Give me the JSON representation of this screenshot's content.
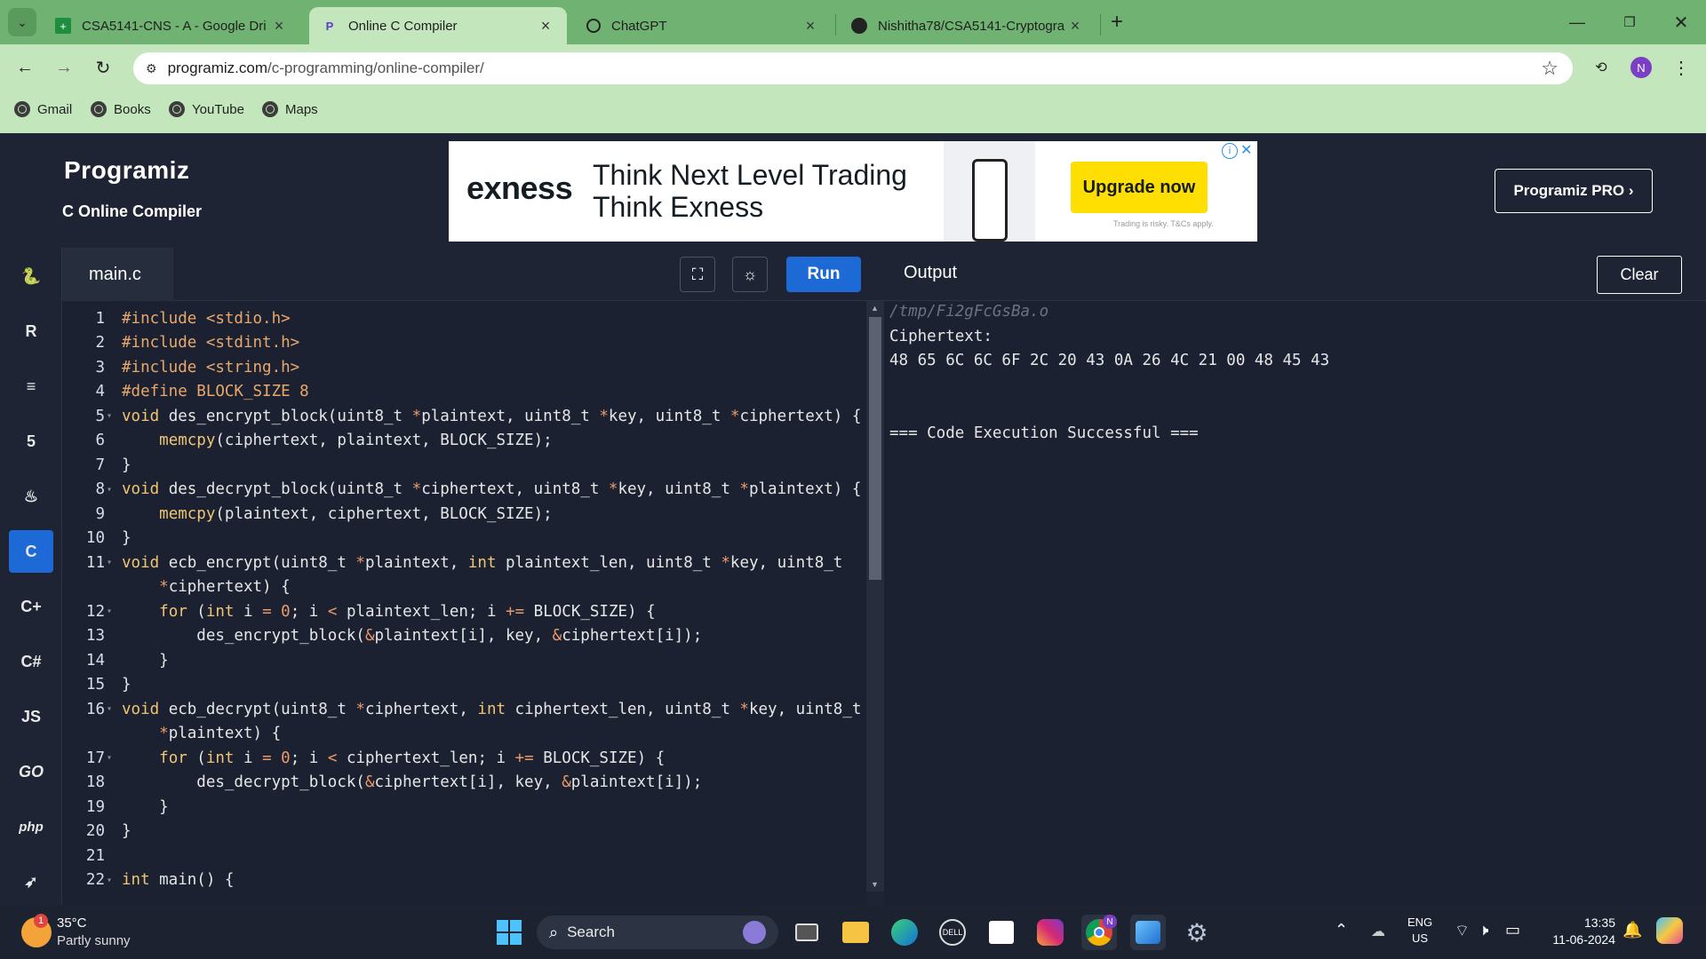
{
  "browser": {
    "tabs": [
      {
        "title": "CSA5141-CNS - A - Google Dri",
        "icon": "google-sheets-icon",
        "active": false
      },
      {
        "title": "Online C Compiler",
        "icon": "programiz-icon",
        "active": true
      },
      {
        "title": "ChatGPT",
        "icon": "chatgpt-icon",
        "active": false
      },
      {
        "title": "Nishitha78/CSA5141-Cryptogra",
        "icon": "github-icon",
        "active": false
      }
    ],
    "url": "programiz.com/c-programming/online-compiler/",
    "url_domain": "programiz.com",
    "url_path": "/c-programming/online-compiler/",
    "profile_initial": "N",
    "bookmarks": [
      "Gmail",
      "Books",
      "YouTube",
      "Maps"
    ]
  },
  "site": {
    "logo": "Programiz",
    "subtitle": "C Online Compiler",
    "pro_button": "Programiz PRO ›",
    "ad": {
      "brand": "exness",
      "line1": "Think Next Level Trading",
      "line2": "Think Exness",
      "cta": "Upgrade now",
      "disclaimer": "Trading is risky. T&Cs apply.",
      "brand_color": "#ffde02"
    }
  },
  "editor": {
    "filename": "main.c",
    "run_label": "Run",
    "lines": [
      {
        "n": "1",
        "fold": false,
        "html": "<span class='pp'>#include &lt;stdio.h&gt;</span>"
      },
      {
        "n": "2",
        "fold": false,
        "html": "<span class='pp'>#include &lt;stdint.h&gt;</span>"
      },
      {
        "n": "3",
        "fold": false,
        "html": "<span class='pp'>#include &lt;string.h&gt;</span>"
      },
      {
        "n": "4",
        "fold": false,
        "html": "<span class='pp'>#define BLOCK_SIZE 8</span>"
      },
      {
        "n": "5",
        "fold": true,
        "html": "<span class='kw'>void</span> des_encrypt_block(uint8_t <span class='op'>*</span>plaintext, uint8_t <span class='op'>*</span>key, uint8_t <span class='op'>*</span>ciphertext) {"
      },
      {
        "n": "6",
        "fold": false,
        "html": "    <span class='fn'>memcpy</span>(ciphertext, plaintext, BLOCK_SIZE);"
      },
      {
        "n": "7",
        "fold": false,
        "html": "}"
      },
      {
        "n": "8",
        "fold": true,
        "html": "<span class='kw'>void</span> des_decrypt_block(uint8_t <span class='op'>*</span>ciphertext, uint8_t <span class='op'>*</span>key, uint8_t <span class='op'>*</span>plaintext) {"
      },
      {
        "n": "9",
        "fold": false,
        "html": "    <span class='fn'>memcpy</span>(plaintext, ciphertext, BLOCK_SIZE);"
      },
      {
        "n": "10",
        "fold": false,
        "html": "}"
      },
      {
        "n": "11",
        "fold": true,
        "html": "<span class='kw'>void</span> ecb_encrypt(uint8_t <span class='op'>*</span>plaintext, <span class='kw'>int</span> plaintext_len, uint8_t <span class='op'>*</span>key, uint8_t"
      },
      {
        "n": "",
        "fold": false,
        "html": "    <span class='op'>*</span>ciphertext) {"
      },
      {
        "n": "12",
        "fold": true,
        "html": "    <span class='kw'>for</span> (<span class='kw'>int</span> i <span class='op'>=</span> <span class='num'>0</span>; i <span class='op'>&lt;</span> plaintext_len; i <span class='op'>+=</span> BLOCK_SIZE) {"
      },
      {
        "n": "13",
        "fold": false,
        "html": "        des_encrypt_block(<span class='op'>&amp;</span>plaintext[i], key, <span class='op'>&amp;</span>ciphertext[i]);"
      },
      {
        "n": "14",
        "fold": false,
        "html": "    }"
      },
      {
        "n": "15",
        "fold": false,
        "html": "}"
      },
      {
        "n": "16",
        "fold": true,
        "html": "<span class='kw'>void</span> ecb_decrypt(uint8_t <span class='op'>*</span>ciphertext, <span class='kw'>int</span> ciphertext_len, uint8_t <span class='op'>*</span>key, uint8_t"
      },
      {
        "n": "",
        "fold": false,
        "html": "    <span class='op'>*</span>plaintext) {"
      },
      {
        "n": "17",
        "fold": true,
        "html": "    <span class='kw'>for</span> (<span class='kw'>int</span> i <span class='op'>=</span> <span class='num'>0</span>; i <span class='op'>&lt;</span> ciphertext_len; i <span class='op'>+=</span> BLOCK_SIZE) {"
      },
      {
        "n": "18",
        "fold": false,
        "html": "        des_decrypt_block(<span class='op'>&amp;</span>ciphertext[i], key, <span class='op'>&amp;</span>plaintext[i]);"
      },
      {
        "n": "19",
        "fold": false,
        "html": "    }"
      },
      {
        "n": "20",
        "fold": false,
        "html": "}"
      },
      {
        "n": "21",
        "fold": false,
        "html": ""
      },
      {
        "n": "22",
        "fold": true,
        "html": "<span class='kw'>int</span> main() {"
      }
    ]
  },
  "output": {
    "title": "Output",
    "clear_label": "Clear",
    "path": "/tmp/Fi2gFcGsBa.o",
    "label": "Ciphertext:",
    "hex": "48 65 6C 6C 6F 2C 20 43 0A 26 4C 21 00 48 45 43",
    "status": "=== Code Execution Successful ==="
  },
  "sidebar": {
    "languages": [
      "python",
      "r",
      "sql",
      "html",
      "java",
      "c",
      "cpp",
      "csharp",
      "js",
      "go",
      "php",
      "swift"
    ],
    "labels": {
      "js": "JS",
      "go": "GO",
      "php": "php"
    },
    "active": "c"
  },
  "taskbar": {
    "weather_temp": "35°C",
    "weather_desc": "Partly sunny",
    "weather_badge": "1",
    "search_placeholder": "Search",
    "lang_line1": "ENG",
    "lang_line2": "US",
    "time": "13:35",
    "date": "11-06-2024",
    "chrome_badge": "N"
  }
}
